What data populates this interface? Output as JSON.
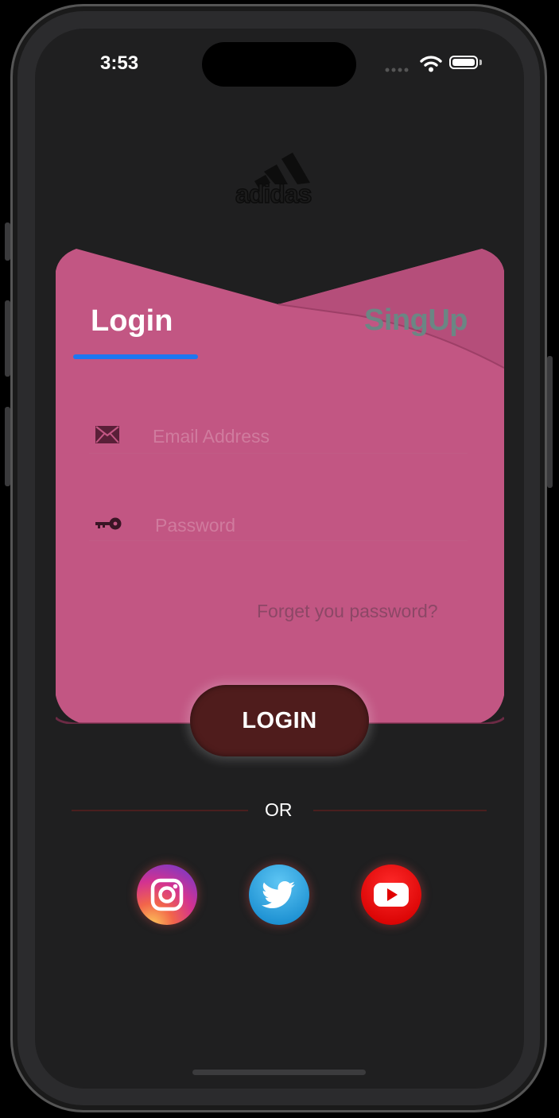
{
  "status_bar": {
    "time": "3:53"
  },
  "brand": {
    "logo_text": "adidas"
  },
  "tabs": {
    "login_label": "Login",
    "signup_label": "SingUp",
    "active_tab": "Login",
    "indicator_color": "#1d77f1"
  },
  "form": {
    "email": {
      "value": "",
      "placeholder": "Email Address",
      "icon": "envelope-icon"
    },
    "password": {
      "value": "",
      "placeholder": "Password",
      "icon": "key-icon"
    },
    "forgot_label": "Forget you password?"
  },
  "login_button": {
    "label": "LOGIN"
  },
  "divider": {
    "label": "OR"
  },
  "social": [
    {
      "name": "instagram",
      "icon": "instagram-icon"
    },
    {
      "name": "twitter",
      "icon": "twitter-icon"
    },
    {
      "name": "youtube",
      "icon": "youtube-icon"
    }
  ],
  "colors": {
    "card": "#c25683",
    "background": "#1f1f20",
    "login_button": "#4f1c1c"
  }
}
